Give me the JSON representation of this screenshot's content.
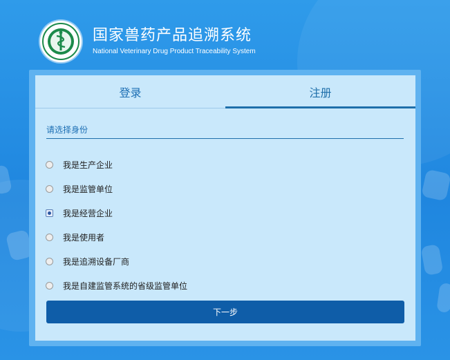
{
  "app": {
    "title_cn": "国家兽药产品追溯系统",
    "title_en": "National Veterinary Drug Product Traceability System"
  },
  "tabs": [
    {
      "label": "登录",
      "active": false
    },
    {
      "label": "注册",
      "active": true
    }
  ],
  "form": {
    "section_label": "请选择身份",
    "options": [
      {
        "label": "我是生产企业",
        "checked": false
      },
      {
        "label": "我是监管单位",
        "checked": false
      },
      {
        "label": "我是经营企业",
        "checked": true
      },
      {
        "label": "我是使用者",
        "checked": false
      },
      {
        "label": "我是追溯设备厂商",
        "checked": false
      },
      {
        "label": "我是自建监管系统的省级监管单位",
        "checked": false
      }
    ],
    "next_label": "下一步"
  },
  "icons": {
    "logo": "veterinary-emblem-icon",
    "radio": "radio-icon"
  },
  "colors": {
    "background": "#1f86df",
    "panel": "#c9e8fb",
    "accent": "#1e6faa",
    "button": "#0f5da8"
  }
}
